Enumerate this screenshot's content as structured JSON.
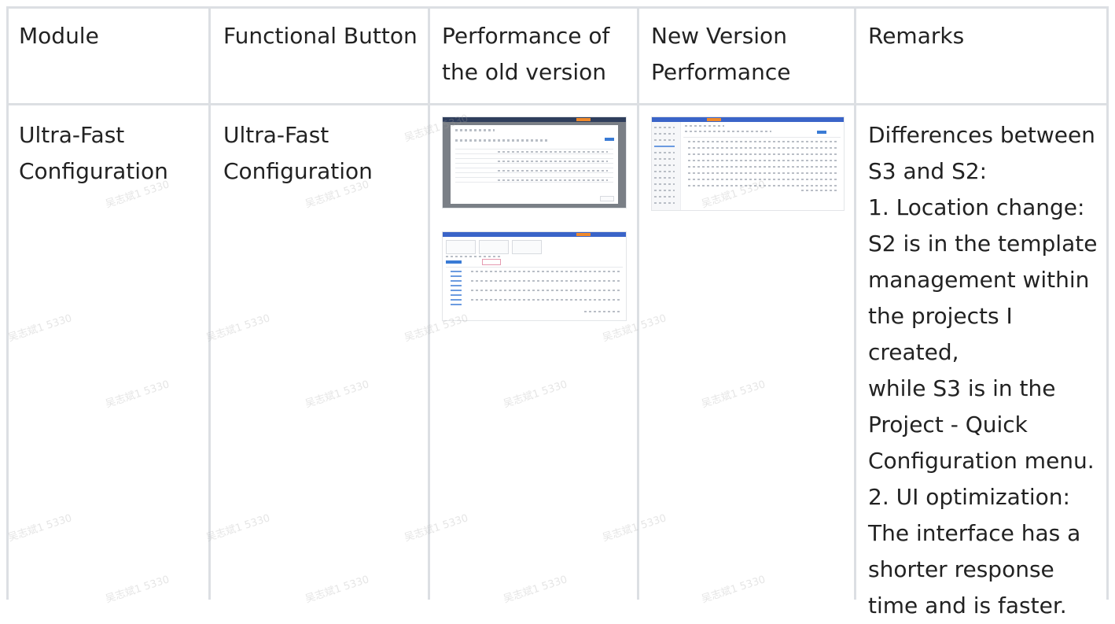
{
  "table": {
    "headers": {
      "module": "Module",
      "functional_button": "Functional Button",
      "old_version": "Performance of\nthe old version",
      "new_version": "New Version\nPerformance",
      "remarks": "Remarks"
    },
    "row": {
      "module": "Ultra-Fast\nConfiguration",
      "functional_button": "Ultra-Fast\nConfiguration",
      "remarks": " Differences between\nS3 and S2:\n1. Location change:\nS2 is in the template\nmanagement within\nthe projects I created,\nwhile S3 is in the\nProject - Quick\nConfiguration menu.\n2. UI optimization:\nThe interface has a\nshorter response\ntime and is faster."
    }
  },
  "watermark": "吴志斌1 5330",
  "colors": {
    "border": "#dcdfe3",
    "text": "#222222",
    "accent": "#3a7bd5",
    "orange": "#f08a2c"
  }
}
